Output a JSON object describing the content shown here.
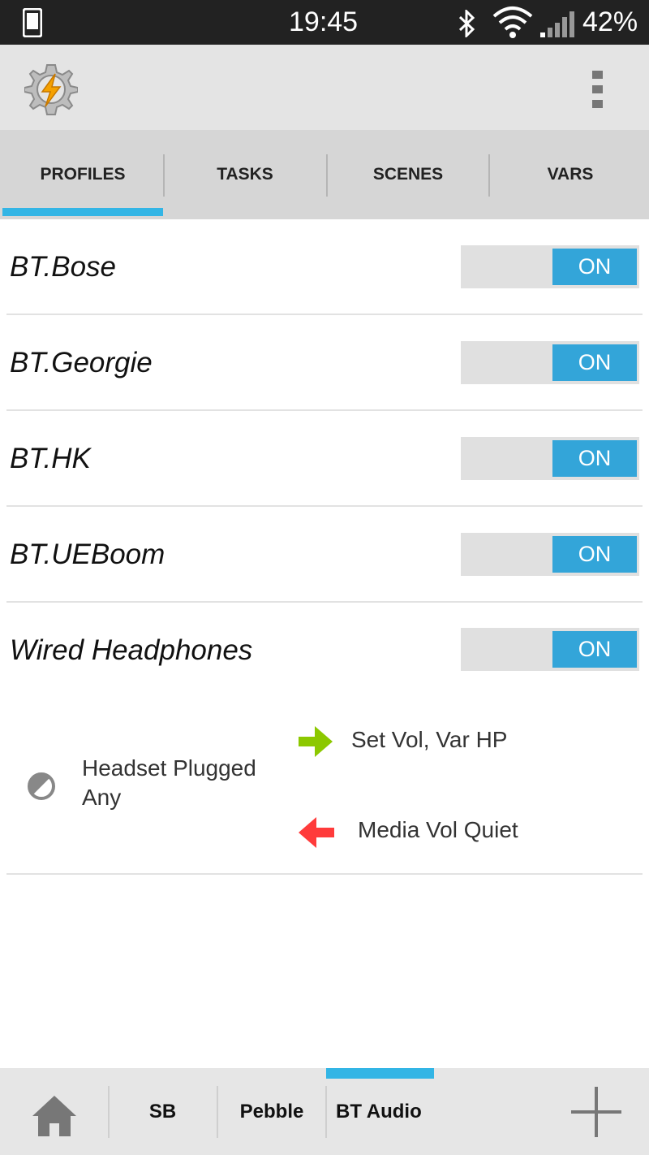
{
  "status": {
    "time": "19:45",
    "battery": "42%"
  },
  "tabs": [
    {
      "label": "PROFILES"
    },
    {
      "label": "TASKS"
    },
    {
      "label": "SCENES"
    },
    {
      "label": "VARS"
    }
  ],
  "profiles": [
    {
      "name": "BT.Bose",
      "toggle": "ON"
    },
    {
      "name": "BT.Georgie",
      "toggle": "ON"
    },
    {
      "name": "BT.HK",
      "toggle": "ON"
    },
    {
      "name": "BT.UEBoom",
      "toggle": "ON"
    },
    {
      "name": "Wired Headphones",
      "toggle": "ON"
    }
  ],
  "expanded": {
    "context_line1": "Headset Plugged",
    "context_line2": "Any",
    "enter_task": "Set Vol, Var HP",
    "exit_task": "Media Vol Quiet"
  },
  "bottom_tabs": [
    {
      "label": "SB"
    },
    {
      "label": "Pebble"
    },
    {
      "label": "BT Audio"
    }
  ],
  "colors": {
    "accent": "#33b5e5",
    "enter_arrow": "#8cc800",
    "exit_arrow": "#ff3b3b"
  }
}
